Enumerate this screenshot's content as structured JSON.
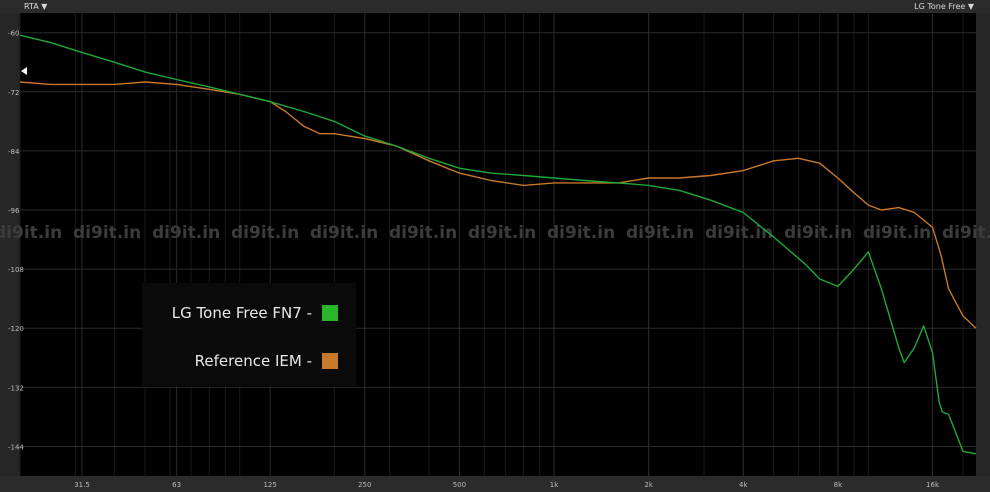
{
  "header": {
    "left_label": "RTA ▼",
    "right_label": "LG Tone Free ▼"
  },
  "watermark": "di9it.in",
  "legend": {
    "items": [
      {
        "label": "LG Tone Free FN7 -",
        "color": "#29b62c"
      },
      {
        "label": "Reference IEM -",
        "color": "#c8782a"
      }
    ]
  },
  "colors": {
    "background": "#000000",
    "grid": "#2a2a2a",
    "tick_text": "#bdbdbd"
  },
  "chart_data": {
    "type": "line",
    "title": "",
    "xlabel": "",
    "ylabel": "",
    "x_scale": "log",
    "xlim": [
      20,
      22000
    ],
    "ylim": [
      -150,
      -56
    ],
    "grid": true,
    "legend_position": "bottom-left",
    "x_ticks": [
      {
        "value": 31.5,
        "label": "31.5"
      },
      {
        "value": 63,
        "label": "63"
      },
      {
        "value": 125,
        "label": "125"
      },
      {
        "value": 250,
        "label": "250"
      },
      {
        "value": 500,
        "label": "500"
      },
      {
        "value": 1000,
        "label": "1k"
      },
      {
        "value": 2000,
        "label": "2k"
      },
      {
        "value": 4000,
        "label": "4k"
      },
      {
        "value": 8000,
        "label": "8k"
      },
      {
        "value": 16000,
        "label": "16k"
      }
    ],
    "y_ticks": [
      {
        "value": -60,
        "label": "-60"
      },
      {
        "value": -72,
        "label": "-72"
      },
      {
        "value": -84,
        "label": "-84"
      },
      {
        "value": -96,
        "label": "-96"
      },
      {
        "value": -108,
        "label": "-108"
      },
      {
        "value": -120,
        "label": "-120"
      },
      {
        "value": -132,
        "label": "-132"
      },
      {
        "value": -144,
        "label": "-144"
      }
    ],
    "series": [
      {
        "name": "LG Tone Free FN7",
        "color": "#1fa83a",
        "x": [
          20,
          25,
          31.5,
          40,
          50,
          63,
          80,
          100,
          125,
          160,
          200,
          250,
          315,
          400,
          500,
          630,
          800,
          1000,
          1250,
          1600,
          2000,
          2500,
          3150,
          4000,
          5000,
          6300,
          7000,
          8000,
          9000,
          10000,
          11000,
          12500,
          13000,
          14000,
          15000,
          16000,
          16800,
          17200,
          18000,
          20000,
          22000
        ],
        "y": [
          -60.5,
          -62,
          -64,
          -66,
          -68,
          -69.5,
          -71,
          -72.5,
          -74,
          -76,
          -78,
          -81,
          -83,
          -85.5,
          -87.5,
          -88.5,
          -89,
          -89.5,
          -90,
          -90.5,
          -91,
          -92,
          -94,
          -96.5,
          -101.5,
          -107,
          -110,
          -111.5,
          -108,
          -104.5,
          -112,
          -124,
          -127,
          -124,
          -119.5,
          -125,
          -135,
          -137,
          -137.5,
          -145,
          -145.5
        ]
      },
      {
        "name": "Reference IEM",
        "color": "#c8782a",
        "x": [
          20,
          25,
          31.5,
          40,
          50,
          63,
          80,
          100,
          125,
          140,
          160,
          180,
          200,
          250,
          315,
          400,
          500,
          630,
          800,
          1000,
          1250,
          1600,
          2000,
          2500,
          3150,
          4000,
          5000,
          6000,
          7000,
          8000,
          9000,
          10000,
          11000,
          12500,
          14000,
          16000,
          17000,
          18000,
          20000,
          22000
        ],
        "y": [
          -70,
          -70.5,
          -70.5,
          -70.5,
          -70,
          -70.5,
          -71.5,
          -72.5,
          -74,
          -76,
          -79,
          -80.5,
          -80.5,
          -81.5,
          -83,
          -86,
          -88.5,
          -90,
          -91,
          -90.5,
          -90.5,
          -90.5,
          -89.5,
          -89.5,
          -89,
          -88,
          -86,
          -85.5,
          -86.5,
          -89.5,
          -92.5,
          -95,
          -96,
          -95.5,
          -96.5,
          -99.5,
          -105,
          -112,
          -117.5,
          -120
        ]
      }
    ]
  }
}
